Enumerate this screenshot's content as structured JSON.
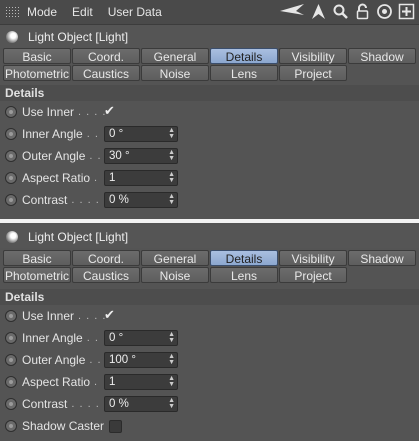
{
  "menubar": {
    "items": [
      "Mode",
      "Edit",
      "User Data"
    ],
    "tool_icons": [
      "arrow-left-icon",
      "arrow-up-icon",
      "search-icon",
      "lock-icon",
      "target-icon",
      "add-icon"
    ]
  },
  "panels": [
    {
      "title": "Light Object [Light]",
      "tabs": [
        [
          "Basic",
          "Coord.",
          "General",
          "Details",
          "Visibility",
          "Shadow"
        ],
        [
          "Photometric",
          "Caustics",
          "Noise",
          "Lens",
          "Project"
        ]
      ],
      "active_tab": "Details",
      "section": "Details",
      "rows": [
        {
          "label": "Use Inner",
          "dots": ". . . .",
          "type": "check",
          "value": "✔"
        },
        {
          "label": "Inner Angle",
          "dots": ". . .",
          "type": "field",
          "value": "0 °"
        },
        {
          "label": "Outer Angle",
          "dots": ". .",
          "type": "field",
          "value": "30 °"
        },
        {
          "label": "Aspect Ratio",
          "dots": ".",
          "type": "field",
          "value": "1"
        },
        {
          "label": "Contrast",
          "dots": ". . . . .",
          "type": "field",
          "value": "0 %"
        }
      ]
    },
    {
      "title": "Light Object [Light]",
      "tabs": [
        [
          "Basic",
          "Coord.",
          "General",
          "Details",
          "Visibility",
          "Shadow"
        ],
        [
          "Photometric",
          "Caustics",
          "Noise",
          "Lens",
          "Project"
        ]
      ],
      "active_tab": "Details",
      "section": "Details",
      "rows": [
        {
          "label": "Use Inner",
          "dots": ". . . .",
          "type": "check",
          "value": "✔"
        },
        {
          "label": "Inner Angle",
          "dots": ". . .",
          "type": "field",
          "value": "0 °"
        },
        {
          "label": "Outer Angle",
          "dots": ". .",
          "type": "field",
          "value": "100 °"
        },
        {
          "label": "Aspect Ratio",
          "dots": ".",
          "type": "field",
          "value": "1"
        },
        {
          "label": "Contrast",
          "dots": ". . . . .",
          "type": "field",
          "value": "0 %"
        },
        {
          "label": "Shadow Caster",
          "dots": "",
          "type": "checkbox",
          "value": ""
        }
      ]
    }
  ],
  "colors": {
    "active_tab": "#8ca7cf",
    "panel_bg": "#545454",
    "separator": "#f2f2f2"
  }
}
